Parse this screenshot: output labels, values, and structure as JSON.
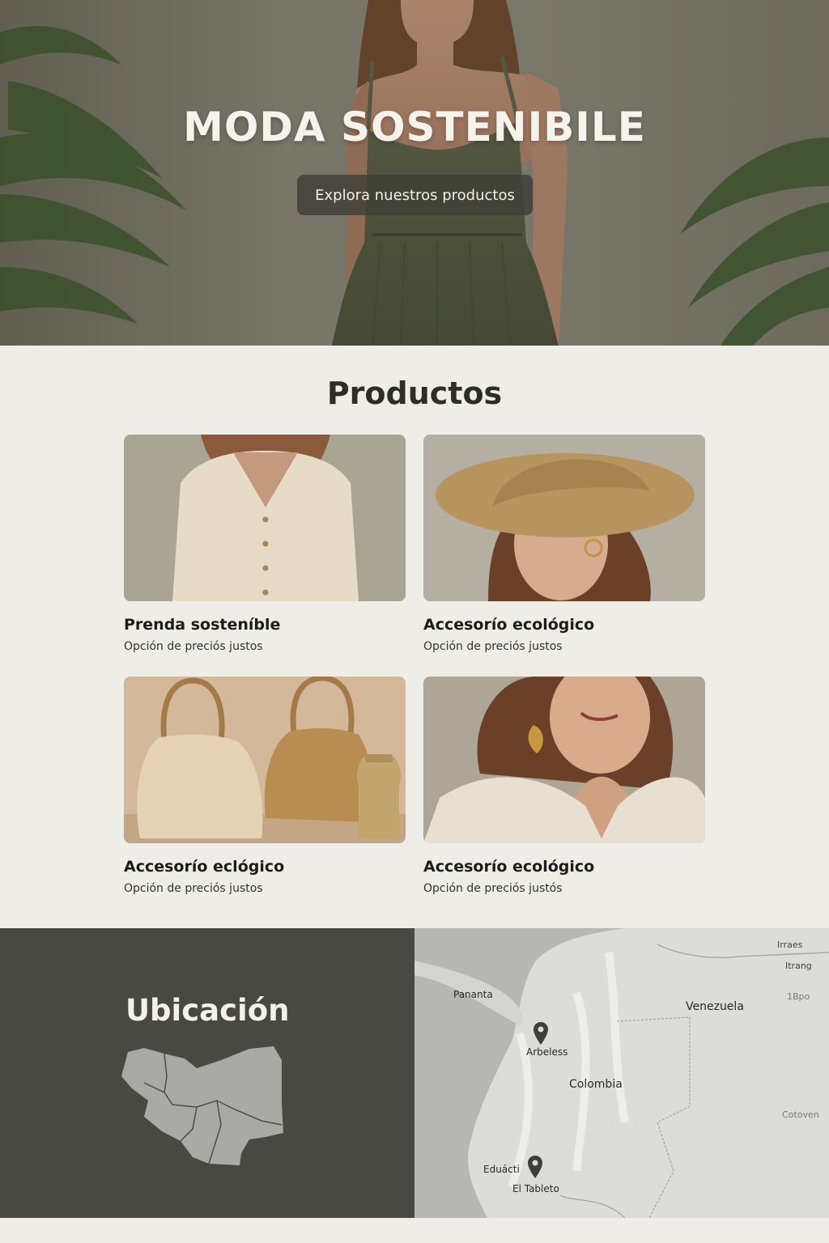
{
  "hero": {
    "title": "MODA SOSTENIBILE",
    "cta_label": "Explora nuestros productos"
  },
  "products": {
    "title": "Productos",
    "items": [
      {
        "name": "Prenda sosteníble",
        "subtitle": "Opción de preciós justos"
      },
      {
        "name": "Accesorío ecológico",
        "subtitle": "Opción de preciós justos"
      },
      {
        "name": "Accesorío eclógico",
        "subtitle": "Opción de preciós justos"
      },
      {
        "name": "Accesorío ecológico",
        "subtitle": "Opción de preciós justós"
      }
    ]
  },
  "location": {
    "title": "Ubicación",
    "map_labels": {
      "irraes": "Irraes",
      "itrang": "Itrang",
      "bpo": "1Bpo",
      "pananta": "Pananta",
      "venezuela": "Venezuela",
      "arbeless": "Arbeless",
      "colombia": "Colombia",
      "cotoven": "Cotoven",
      "eduacti": "Eduácti",
      "eltableto": "El Tableto"
    }
  },
  "colors": {
    "background": "#efede8",
    "location_panel": "#484943",
    "button": "#3e3e37"
  }
}
